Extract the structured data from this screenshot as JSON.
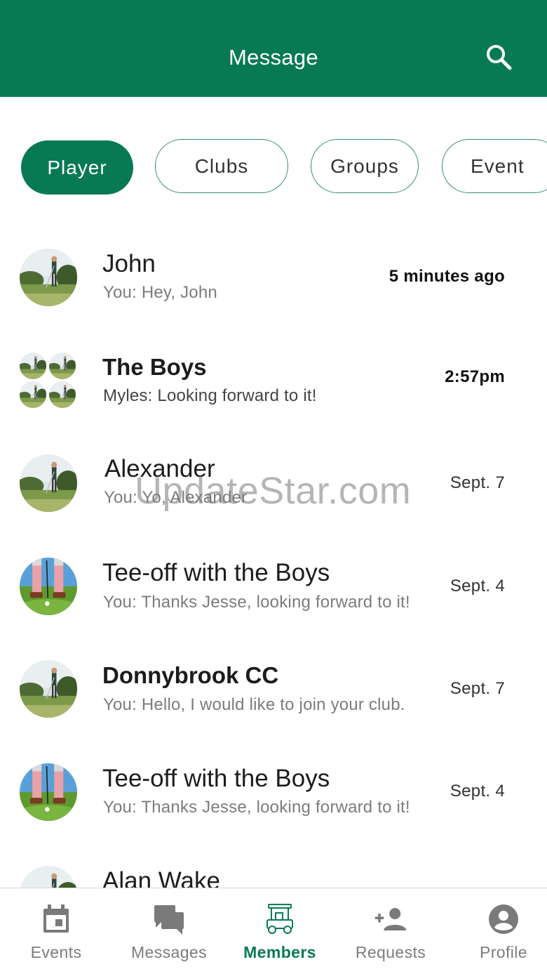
{
  "header": {
    "title": "Message",
    "search_icon": "search-icon"
  },
  "tabs": [
    {
      "label": "Player",
      "active": true
    },
    {
      "label": "Clubs",
      "active": false
    },
    {
      "label": "Groups",
      "active": false
    },
    {
      "label": "Event",
      "active": false
    }
  ],
  "conversations": [
    {
      "name": "John",
      "preview": "You: Hey, John",
      "time": "5 minutes ago",
      "unread": false,
      "time_bold": true,
      "avatar": "golfer-photo"
    },
    {
      "name": "The Boys",
      "preview": "Myles: Looking forward to it!",
      "time": "2:57pm",
      "unread": true,
      "time_bold": true,
      "avatar": "group-golfer-photos"
    },
    {
      "name": "Alexander",
      "preview": "You: Yo, Alexander",
      "time": "Sept. 7",
      "unread": false,
      "time_bold": false,
      "avatar": "golfer-photo"
    },
    {
      "name": "Tee-off with the Boys",
      "preview": "You: Thanks Jesse, looking forward to it!",
      "time": "Sept. 4",
      "unread": false,
      "time_bold": false,
      "avatar": "putting-photo"
    },
    {
      "name": "Donnybrook CC",
      "preview": "You: Hello, I would like to join your club.",
      "time": "Sept. 7",
      "unread": true,
      "time_bold": false,
      "avatar": "golfer-photo"
    },
    {
      "name": "Tee-off with the Boys",
      "preview": "You: Thanks Jesse, looking forward to it!",
      "time": "Sept. 4",
      "unread": false,
      "time_bold": false,
      "avatar": "putting-photo"
    },
    {
      "name": "Alan Wake",
      "preview": "",
      "time": "",
      "unread": false,
      "time_bold": false,
      "avatar": "golfer-photo"
    }
  ],
  "watermark": "UpdateStar.com",
  "bottom_nav": [
    {
      "label": "Events",
      "icon": "calendar-icon",
      "active": false
    },
    {
      "label": "Messages",
      "icon": "chat-bubbles-icon",
      "active": false
    },
    {
      "label": "Members",
      "icon": "golf-cart-icon",
      "active": true
    },
    {
      "label": "Requests",
      "icon": "add-person-icon",
      "active": false
    },
    {
      "label": "Profile",
      "icon": "account-circle-icon",
      "active": false
    }
  ],
  "colors": {
    "brand_green": "#077a53",
    "chip_border": "#2f8f6a",
    "muted_text": "#7c7c7c",
    "nav_inactive": "#7d7d7d"
  }
}
